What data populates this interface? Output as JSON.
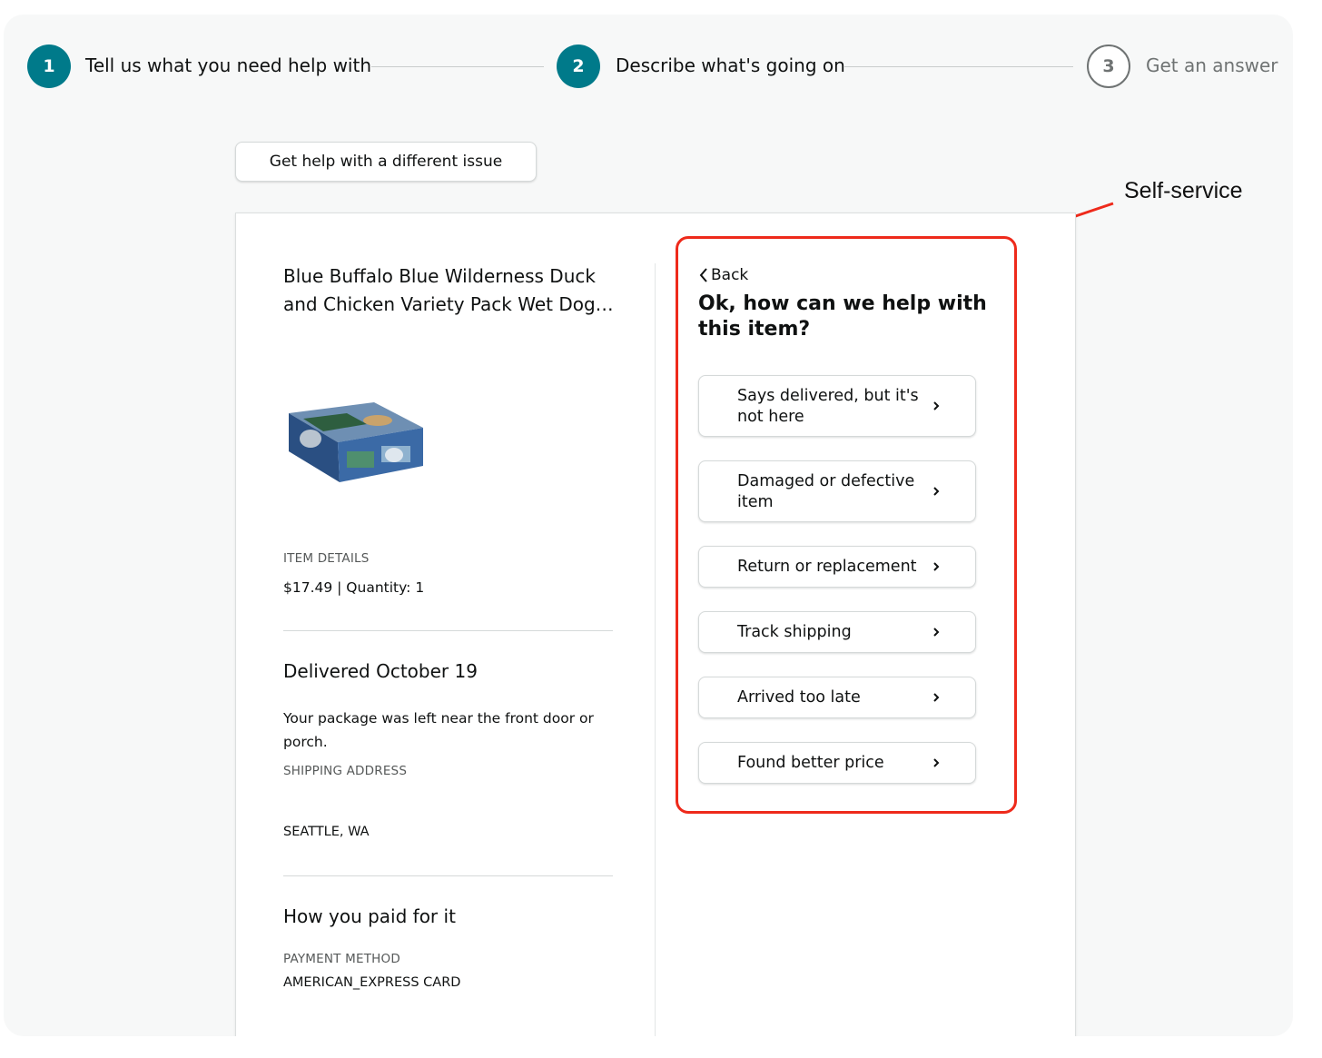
{
  "stepper": {
    "steps": [
      {
        "number": "1",
        "label": "Tell us what you need help with",
        "state": "completed"
      },
      {
        "number": "2",
        "label": "Describe what's going on",
        "state": "current"
      },
      {
        "number": "3",
        "label": "Get an answer",
        "state": "upcoming"
      }
    ]
  },
  "different_issue_button": "Get help with a different issue",
  "annotation": {
    "label": "Self-service",
    "color": "#ee2a1b"
  },
  "item": {
    "title": "Blue Buffalo Blue Wilderness Duck and Chicken Variety Pack Wet Dog…",
    "details_label": "ITEM DETAILS",
    "details_value": "$17.49 | Quantity: 1",
    "delivery_title": "Delivered October 19",
    "delivery_note": "Your package was left near the front door or porch.",
    "shipping_label": "SHIPPING ADDRESS",
    "shipping_value": "SEATTLE, WA",
    "payment_title": "How you paid for it",
    "payment_label": "PAYMENT METHOD",
    "payment_value": "AMERICAN_EXPRESS CARD"
  },
  "self_service": {
    "back_label": "Back",
    "title": "Ok, how can we help with this item?",
    "options": [
      {
        "label": "Says delivered, but it's not here"
      },
      {
        "label": "Damaged or defective item"
      },
      {
        "label": "Return or replacement"
      },
      {
        "label": "Track shipping"
      },
      {
        "label": "Arrived too late"
      },
      {
        "label": "Found better price"
      }
    ]
  },
  "colors": {
    "step_active": "#007a8a",
    "highlight_border": "#ee2a1b",
    "background": "#f7f8f8"
  },
  "icons": [
    "chevron-left-icon",
    "chevron-right-icon",
    "arrow-icon",
    "product-image"
  ]
}
